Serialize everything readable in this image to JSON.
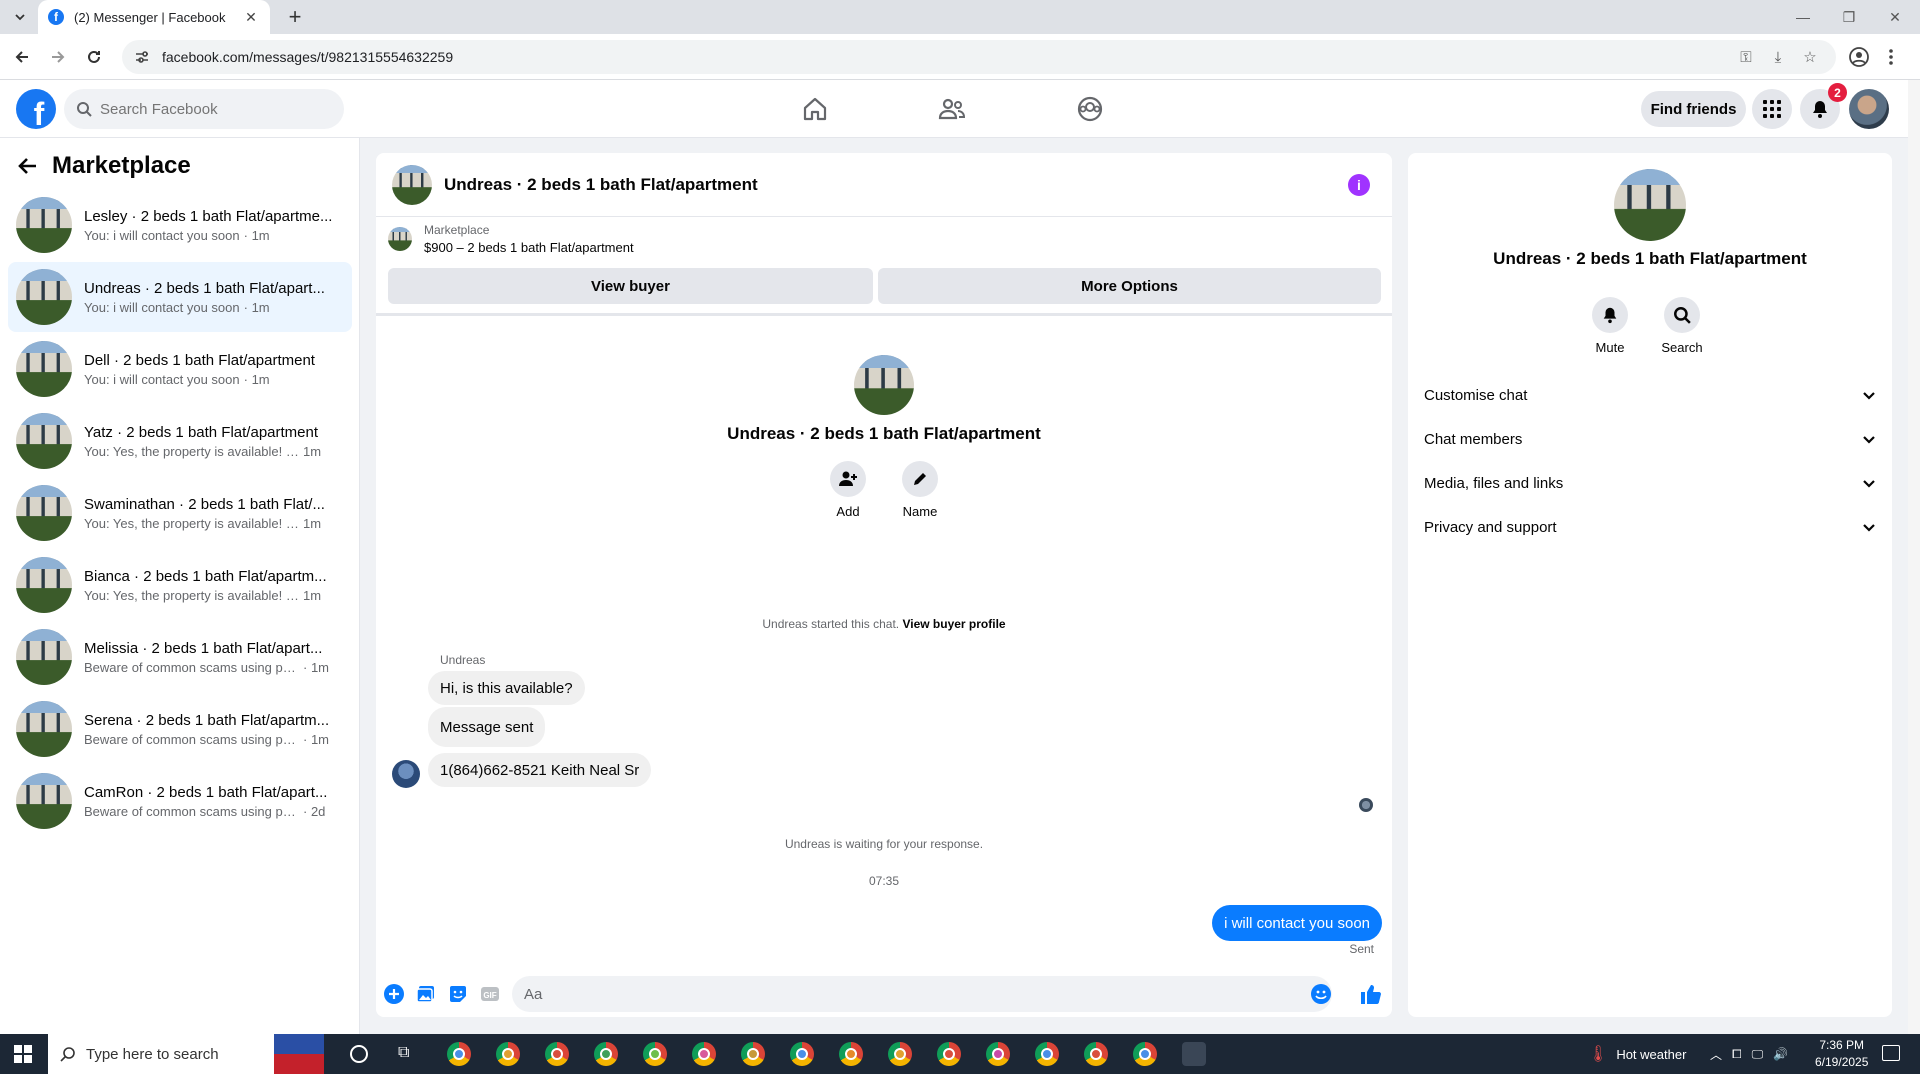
{
  "browser": {
    "tab_title": "(2) Messenger | Facebook",
    "url": "facebook.com/messages/t/9821315554632259"
  },
  "fb": {
    "search_placeholder": "Search Facebook",
    "find_friends": "Find friends",
    "notif_count": "2"
  },
  "sidebar": {
    "title": "Marketplace",
    "conversations": [
      {
        "name": "Lesley · 2 beds 1 bath Flat/apartme...",
        "preview": "You: i will contact you soon",
        "time": "· 1m"
      },
      {
        "name": "Undreas · 2 beds 1 bath Flat/apart...",
        "preview": "You: i will contact you soon",
        "time": "· 1m",
        "active": true
      },
      {
        "name": "Dell · 2 beds 1 bath Flat/apartment",
        "preview": "You: i will contact you soon",
        "time": "· 1m"
      },
      {
        "name": "Yatz · 2 beds 1 bath Flat/apartment",
        "preview": "You: Yes, the property is available! Ple...",
        "time": "1m"
      },
      {
        "name": "Swaminathan · 2 beds 1 bath Flat/...",
        "preview": "You: Yes, the property is available! Ple...",
        "time": "1m"
      },
      {
        "name": "Bianca · 2 beds 1 bath Flat/apartm...",
        "preview": "You: Yes, the property is available! Ple...",
        "time": "1m"
      },
      {
        "name": "Melissia · 2 beds 1 bath Flat/apart...",
        "preview": "Beware of common scams using pay...",
        "time": "· 1m"
      },
      {
        "name": "Serena · 2 beds 1 bath Flat/apartm...",
        "preview": "Beware of common scams using pay...",
        "time": "· 1m"
      },
      {
        "name": "CamRon · 2 beds 1 bath Flat/apart...",
        "preview": "Beware of common scams using pay...",
        "time": "· 2d"
      }
    ]
  },
  "chat": {
    "title": "Undreas · 2 beds 1 bath Flat/apartment",
    "marketplace_label": "Marketplace",
    "listing": "$900 – 2 beds 1 bath Flat/apartment",
    "view_buyer": "View buyer",
    "more_options": "More Options",
    "center_name": "Undreas · 2 beds 1 bath Flat/apartment",
    "add_label": "Add",
    "name_label": "Name",
    "started_text": "Undreas started this chat.",
    "view_profile": "View buyer profile",
    "sender": "Undreas",
    "messages": [
      "Hi, is this available?",
      "Message sent",
      "1(864)662-8521 Keith Neal Sr"
    ],
    "waiting": "Undreas is waiting for your response.",
    "time": "07:35",
    "my_message": "i will contact you soon",
    "sent": "Sent",
    "input_placeholder": "Aa"
  },
  "info": {
    "name": "Undreas · 2 beds 1 bath Flat/apartment",
    "mute": "Mute",
    "search": "Search",
    "sections": [
      "Customise chat",
      "Chat members",
      "Media, files and links",
      "Privacy and support"
    ]
  },
  "taskbar": {
    "search_placeholder": "Type here to search",
    "weather": "Hot weather",
    "time": "7:36 PM",
    "date": "6/19/2025"
  },
  "colors": {
    "fb_blue": "#1877f2",
    "messenger_blue": "#0a7cff",
    "info_purple": "#a033ff"
  }
}
